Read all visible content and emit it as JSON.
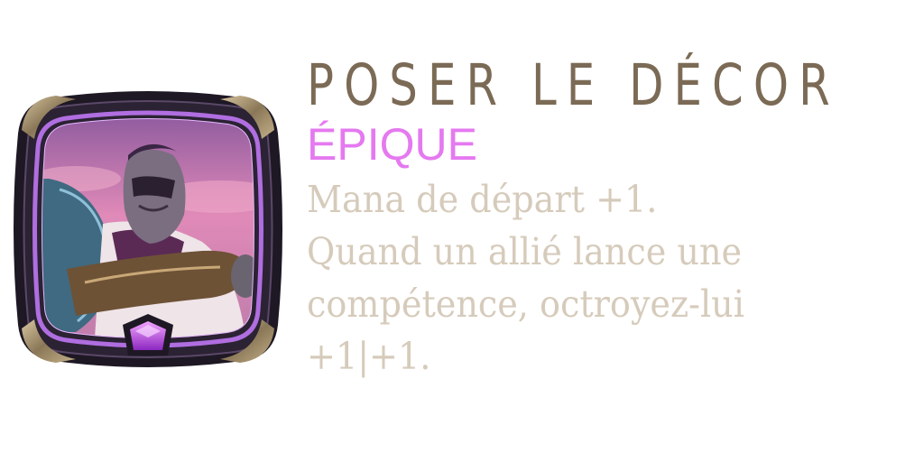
{
  "augment": {
    "title": "POSER LE DÉCOR",
    "rarity": "ÉPIQUE",
    "rarity_color": "#e579f0",
    "title_color": "#7b6a55",
    "text_color": "#d6cbbb",
    "description_lines": [
      "Mana de départ +1.",
      "Quand un allié lance une",
      "compétence, octroyez-lui",
      "+1|+1."
    ],
    "portrait_icon": "champion-portrait-icon",
    "gem_icon": "epic-gem-icon"
  }
}
